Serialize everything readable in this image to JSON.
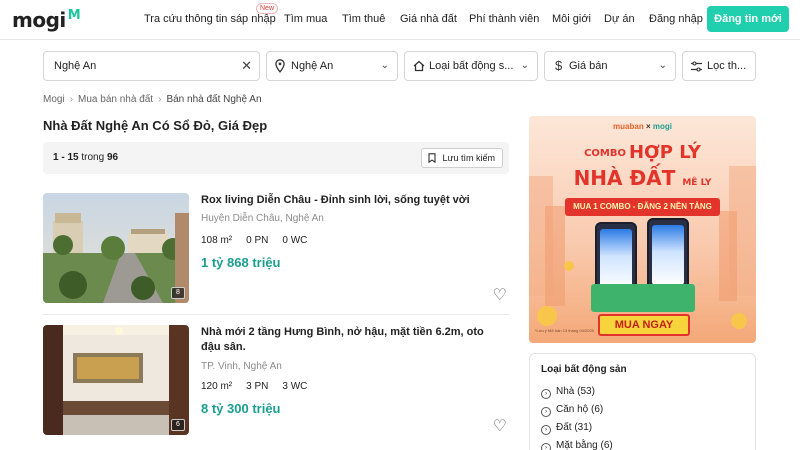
{
  "header": {
    "logo_text": "mogi",
    "logo_mark": "M",
    "nav": [
      {
        "label": "Tra cứu thông tin sáp nhập"
      },
      {
        "label": "Tìm mua"
      },
      {
        "label": "Tìm thuê"
      },
      {
        "label": "Giá nhà đất"
      },
      {
        "label": "Phí thành viên"
      },
      {
        "label": "Môi giới"
      },
      {
        "label": "Dự án"
      },
      {
        "label": "Đăng nhập"
      }
    ],
    "new_badge": "New",
    "post_button": "Đăng tin mới"
  },
  "filters": {
    "search_value": "Nghệ An",
    "location": "Nghệ An",
    "property_type": "Loại bất động s...",
    "price": "Giá bán",
    "more": "Lọc th..."
  },
  "breadcrumb": [
    "Mogi",
    "Mua bán nhà đất",
    "Bán nhà đất Nghệ An"
  ],
  "page_title": "Nhà Đất Nghệ An Có Sổ Đỏ, Giá Đẹp",
  "results": {
    "range": "1 - 15",
    "word": "trong",
    "total": "96",
    "save_search": "Lưu tìm kiếm"
  },
  "listings": [
    {
      "title": "Rox living Diễn Châu - Đỉnh sinh lời, sống tuyệt vời",
      "address": "Huyện Diễn Châu, Nghệ An",
      "area": "108 m²",
      "bedrooms": "0 PN",
      "bathrooms": "0 WC",
      "price": "1 tỷ 868 triệu",
      "photo_count": "8"
    },
    {
      "title": "Nhà mới 2 tầng Hưng Bình, nở hậu, mặt tiền 6.2m, oto đậu sân.",
      "address": "TP. Vinh, Nghệ An",
      "area": "120 m²",
      "bedrooms": "3 PN",
      "bathrooms": "3 WC",
      "price": "8 tỷ 300 triệu",
      "photo_count": "6"
    }
  ],
  "ad": {
    "brand_left": "muaban",
    "brand_x": "×",
    "brand_right": "mogi",
    "combo_word": "COMBO",
    "headline_1": "HỢP LÝ",
    "headline_2": "NHÀ ĐẤT",
    "headline_suffix": "MÊ LY",
    "ribbon": "MUA 1 COMBO - ĐĂNG 2 NỀN TẢNG",
    "cta": "MUA NGAY",
    "note": "*Lưu ý Mở bán 13 tháng 04/2025"
  },
  "property_types": {
    "title": "Loại bất động sản",
    "items": [
      {
        "label": "Nhà",
        "count": "(53)"
      },
      {
        "label": "Căn hộ",
        "count": "(6)"
      },
      {
        "label": "Đất",
        "count": "(31)"
      },
      {
        "label": "Mặt bằng",
        "count": "(6)"
      }
    ]
  },
  "colors": {
    "brand": "#1fcfae",
    "price": "#1a9e8f",
    "ad_red": "#e2342a"
  }
}
